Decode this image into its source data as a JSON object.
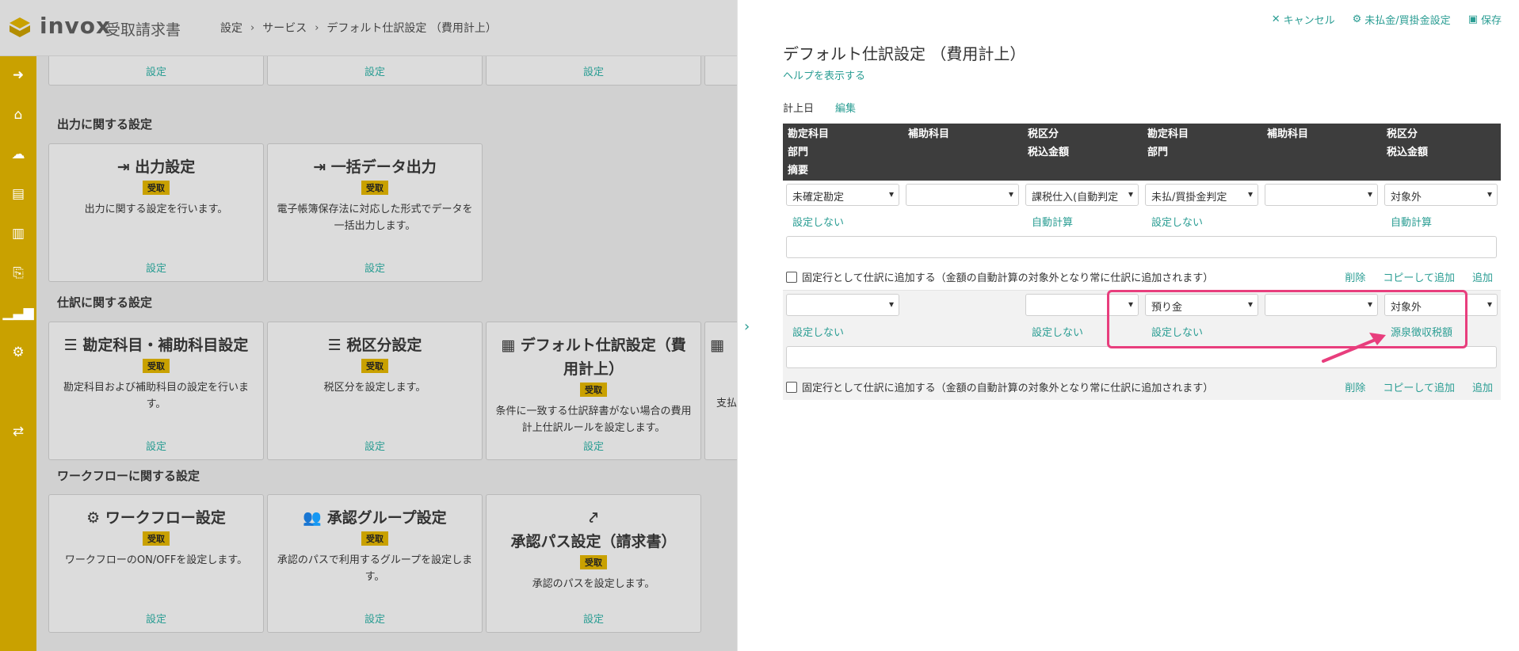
{
  "app": {
    "logo_name": "invox",
    "logo_sub": "受取請求書",
    "breadcrumb": [
      "設定",
      "サービス",
      "デフォルト仕訳設定 （費用計上）"
    ]
  },
  "rail": [
    "arrow-right-circle-icon",
    "home-icon",
    "cloud-upload-icon",
    "file-icon",
    "building-icon",
    "file-export-icon",
    "chart-icon",
    "gear-icon",
    "transfer-icon"
  ],
  "left": {
    "top_row_label": "設定",
    "sections": [
      "出力に関する設定",
      "仕訳に関する設定",
      "ワークフローに関する設定"
    ],
    "badge": "受取",
    "cards": [
      {
        "title": "出力設定",
        "desc": "出力に関する設定を行います。",
        "link": "設定"
      },
      {
        "title": "一括データ出力",
        "desc": "電子帳簿保存法に対応した形式でデータを一括出力します。",
        "link": "設定"
      },
      {
        "title": "勘定科目・補助科目設定",
        "desc": "勘定科目および補助科目の設定を行います。",
        "link": "設定"
      },
      {
        "title": "税区分設定",
        "desc": "税区分を設定します。",
        "link": "設定"
      },
      {
        "title": "デフォルト仕訳設定（費用計上）",
        "desc": "条件に一致する仕訳辞書がない場合の費用計上仕訳ルールを設定します。",
        "link": "設定"
      },
      {
        "title": "",
        "desc": "支払",
        "link": ""
      },
      {
        "title": "ワークフロー設定",
        "desc": "ワークフローのON/OFFを設定します。",
        "link": "設定"
      },
      {
        "title": "承認グループ設定",
        "desc": "承認のパスで利用するグループを設定します。",
        "link": "設定"
      },
      {
        "title": "承認パス設定（請求書）",
        "desc": "承認のパスを設定します。",
        "link": "設定"
      }
    ]
  },
  "panel": {
    "actions": {
      "cancel": "キャンセル",
      "ap_setting": "未払金/買掛金設定",
      "save": "保存"
    },
    "title": "デフォルト仕訳設定 （費用計上）",
    "help": "ヘルプを表示する",
    "posting_date_label": "計上日",
    "edit_label": "編集",
    "headers": [
      [
        "勘定科目",
        "部門",
        "摘要"
      ],
      [
        "補助科目"
      ],
      [
        "税区分",
        "税込金額"
      ],
      [
        "勘定科目",
        "部門"
      ],
      [
        "補助科目"
      ],
      [
        "税区分",
        "税込金額"
      ]
    ],
    "rows": [
      {
        "selects": [
          "未確定勘定",
          "",
          "課税仕入(自動判定",
          "未払/買掛金判定",
          "",
          "対象外"
        ],
        "links": [
          "設定しない",
          "自動計算",
          "設定しない",
          "自動計算"
        ],
        "fixed_label": "固定行として仕訳に追加する（金額の自動計算の対象外となり常に仕訳に追加されます）",
        "ops": [
          "削除",
          "コピーして追加",
          "追加"
        ]
      },
      {
        "selects": [
          "",
          "",
          "預り金",
          "",
          "対象外"
        ],
        "links": [
          "設定しない",
          "設定しない",
          "設定しない",
          "源泉徴収税額"
        ],
        "fixed_label": "固定行として仕訳に追加する（金額の自動計算の対象外となり常に仕訳に追加されます）",
        "ops": [
          "削除",
          "コピーして追加",
          "追加"
        ]
      }
    ]
  },
  "annotation": {
    "highlight_color": "#e83e7d"
  }
}
